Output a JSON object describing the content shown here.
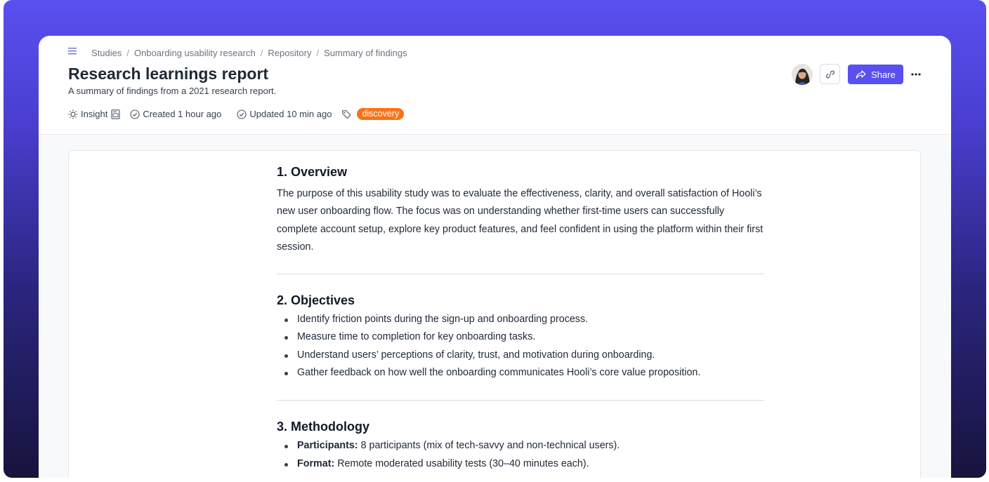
{
  "breadcrumb": [
    "Studies",
    "Onboarding usability research",
    "Repository",
    "Summary of findings"
  ],
  "page": {
    "title": "Research learnings report",
    "subtitle": "A summary of findings from a 2021 research report."
  },
  "meta": {
    "type_label": "Insight",
    "created": "Created 1 hour ago",
    "updated": "Updated 10 min ago",
    "tag": "discovery"
  },
  "actions": {
    "share_label": "Share"
  },
  "colors": {
    "accent": "#5a4ff0",
    "tag": "#f97316"
  },
  "document": {
    "overview": {
      "heading": "1. Overview",
      "body": "The purpose of this usability study was to evaluate the effectiveness, clarity, and overall satisfaction of Hooli’s new user onboarding flow. The focus was on understanding whether first-time users can successfully complete account setup, explore key product features, and feel confident in using the platform within their first session."
    },
    "objectives": {
      "heading": "2. Objectives",
      "items": [
        "Identify friction points during the sign-up and onboarding process.",
        "Measure time to completion for key onboarding tasks.",
        "Understand users’ perceptions of clarity, trust, and motivation during onboarding.",
        "Gather feedback on how well the onboarding communicates Hooli’s core value proposition."
      ]
    },
    "methodology": {
      "heading": "3. Methodology",
      "items": [
        {
          "label": "Participants:",
          "text": " 8 participants (mix of tech-savvy and non-technical users)."
        },
        {
          "label": "Format:",
          "text": " Remote moderated usability tests (30–40 minutes each)."
        }
      ]
    }
  }
}
